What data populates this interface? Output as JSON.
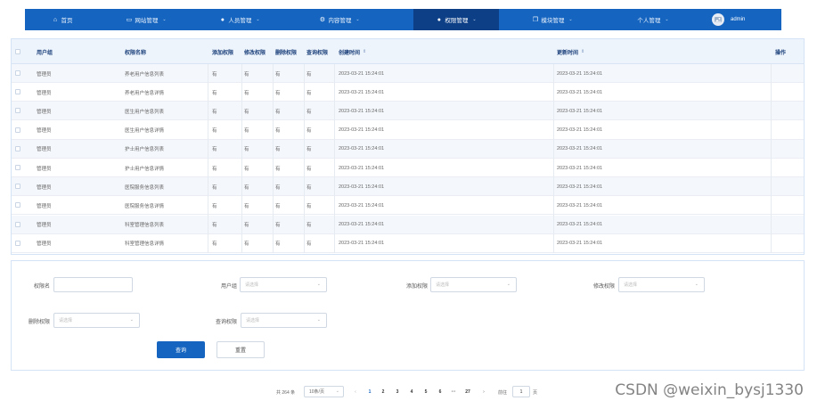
{
  "nav": {
    "items": [
      {
        "label": "首页",
        "icon": "home-icon",
        "chevron": ""
      },
      {
        "label": "网站管理",
        "icon": "monitor-icon",
        "chevron": "⌄"
      },
      {
        "label": "人员管理",
        "icon": "user-icon",
        "chevron": "⌄"
      },
      {
        "label": "内容管理",
        "icon": "gear-icon",
        "chevron": "⌄"
      },
      {
        "label": "权限管理",
        "icon": "user-icon",
        "chevron": "⌄"
      },
      {
        "label": "模块管理",
        "icon": "copy-icon",
        "chevron": "⌄"
      },
      {
        "label": "个人管理",
        "icon": "",
        "chevron": "⌄"
      }
    ],
    "active_index": 4,
    "user": "admin"
  },
  "table": {
    "headers": {
      "user_group": "用户组",
      "perm_name": "权限名称",
      "add": "添加权限",
      "edit": "修改权限",
      "delete": "删除权限",
      "query": "查询权限",
      "created": "创建时间",
      "updated": "更新时间",
      "ops": "操作"
    },
    "sort_icon": "⇕",
    "rows": [
      {
        "user_group": "管理员",
        "perm_name": "养老用户信息列表",
        "add": "有",
        "edit": "有",
        "delete": "有",
        "query": "有",
        "created": "2023-03-21 15:24:01",
        "updated": "2023-03-21 15:24:01"
      },
      {
        "user_group": "管理员",
        "perm_name": "养老用户信息详情",
        "add": "有",
        "edit": "有",
        "delete": "有",
        "query": "有",
        "created": "2023-03-21 15:24:01",
        "updated": "2023-03-21 15:24:01"
      },
      {
        "user_group": "管理员",
        "perm_name": "医生用户信息列表",
        "add": "有",
        "edit": "有",
        "delete": "有",
        "query": "有",
        "created": "2023-03-21 15:24:01",
        "updated": "2023-03-21 15:24:01"
      },
      {
        "user_group": "管理员",
        "perm_name": "医生用户信息详情",
        "add": "有",
        "edit": "有",
        "delete": "有",
        "query": "有",
        "created": "2023-03-21 15:24:01",
        "updated": "2023-03-21 15:24:01"
      },
      {
        "user_group": "管理员",
        "perm_name": "护士用户信息列表",
        "add": "有",
        "edit": "有",
        "delete": "有",
        "query": "有",
        "created": "2023-03-21 15:24:01",
        "updated": "2023-03-21 15:24:01"
      },
      {
        "user_group": "管理员",
        "perm_name": "护士用户信息详情",
        "add": "有",
        "edit": "有",
        "delete": "有",
        "query": "有",
        "created": "2023-03-21 15:24:01",
        "updated": "2023-03-21 15:24:01"
      },
      {
        "user_group": "管理员",
        "perm_name": "医院服务信息列表",
        "add": "有",
        "edit": "有",
        "delete": "有",
        "query": "有",
        "created": "2023-03-21 15:24:01",
        "updated": "2023-03-21 15:24:01"
      },
      {
        "user_group": "管理员",
        "perm_name": "医院服务信息详情",
        "add": "有",
        "edit": "有",
        "delete": "有",
        "query": "有",
        "created": "2023-03-21 15:24:01",
        "updated": "2023-03-21 15:24:01"
      },
      {
        "user_group": "管理员",
        "perm_name": "科室管理信息列表",
        "add": "有",
        "edit": "有",
        "delete": "有",
        "query": "有",
        "created": "2023-03-21 15:24:01",
        "updated": "2023-03-21 15:24:01"
      },
      {
        "user_group": "管理员",
        "perm_name": "科室管理信息详情",
        "add": "有",
        "edit": "有",
        "delete": "有",
        "query": "有",
        "created": "2023-03-21 15:24:01",
        "updated": "2023-03-21 15:24:01"
      }
    ]
  },
  "filters": {
    "perm_name_label": "权限名",
    "user_group_label": "用户组",
    "add_label": "添加权限",
    "edit_label": "修改权限",
    "delete_label": "删除权限",
    "query_label": "查询权限",
    "select_placeholder": "请选择",
    "query_button": "查询",
    "reset_button": "重置"
  },
  "pagination": {
    "total": "共 264 条",
    "page_size": "10条/页",
    "pages": [
      "1",
      "2",
      "3",
      "4",
      "5",
      "6",
      "···",
      "27"
    ],
    "active_page": "1",
    "prev": "‹",
    "next": "›",
    "goto_label": "前往",
    "goto_value": "1",
    "goto_suffix": "页"
  },
  "watermark": "CSDN @weixin_bysj1330",
  "colors": {
    "nav_bg": "#1565c0",
    "nav_active": "#0d3f87",
    "header_text": "#1a3f7a"
  }
}
